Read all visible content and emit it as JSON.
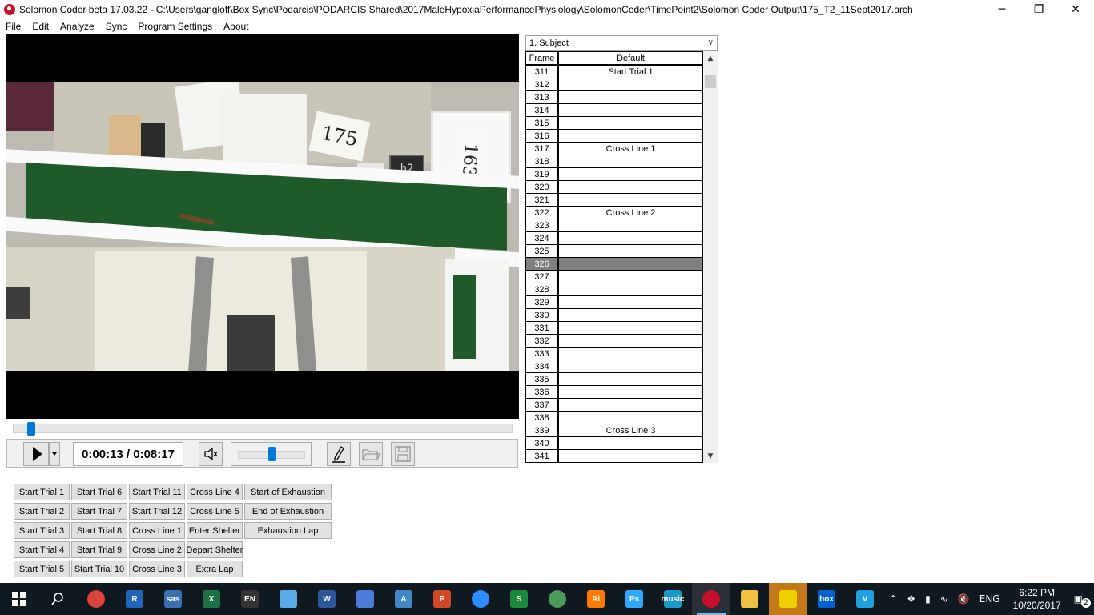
{
  "window": {
    "title": "Solomon Coder beta 17.03.22  -  C:\\Users\\gangloff\\Box Sync\\Podarcis\\PODARCIS Shared\\2017MaleHypoxiaPerformancePhysiology\\SolomonCoder\\TimePoint2\\Solomon Coder Output\\175_T2_11Sept2017.arch",
    "minimize": "─",
    "restore": "❐",
    "close": "✕"
  },
  "menu": [
    "File",
    "Edit",
    "Analyze",
    "Sync",
    "Program Settings",
    "About"
  ],
  "video": {
    "card_number": "175",
    "side_number": "163",
    "timer_display": "h2",
    "seek_position": 0.027
  },
  "player": {
    "time": "0:00:13 / 0:08:17",
    "volume_level": 0.5
  },
  "behaviors": [
    [
      "Start Trial 1",
      "Start Trial 2",
      "Start Trial 3",
      "Start Trial 4",
      "Start Trial 5"
    ],
    [
      "Start Trial 6",
      "Start Trial 7",
      "Start Trial 8",
      "Start Trial 9",
      "Start Trial 10"
    ],
    [
      "Start Trial 11",
      "Start Trial 12",
      "Cross Line 1",
      "Cross Line 2",
      "Cross Line 3"
    ],
    [
      "Cross Line 4",
      "Cross Line 5",
      "Enter Shelter",
      "Depart Shelter",
      "Extra Lap"
    ],
    [
      "Start of Exhaustion",
      "End of Exhaustion",
      "Exhaustion Lap"
    ]
  ],
  "subject_select": "1. Subject",
  "grid": {
    "headers": {
      "frame": "Frame",
      "default": "Default"
    },
    "selected_frame": "326",
    "rows": [
      {
        "frame": "311",
        "label": "Start Trial 1"
      },
      {
        "frame": "312",
        "label": ""
      },
      {
        "frame": "313",
        "label": ""
      },
      {
        "frame": "314",
        "label": ""
      },
      {
        "frame": "315",
        "label": ""
      },
      {
        "frame": "316",
        "label": ""
      },
      {
        "frame": "317",
        "label": "Cross Line 1"
      },
      {
        "frame": "318",
        "label": ""
      },
      {
        "frame": "319",
        "label": ""
      },
      {
        "frame": "320",
        "label": ""
      },
      {
        "frame": "321",
        "label": ""
      },
      {
        "frame": "322",
        "label": "Cross Line 2"
      },
      {
        "frame": "323",
        "label": ""
      },
      {
        "frame": "324",
        "label": ""
      },
      {
        "frame": "325",
        "label": ""
      },
      {
        "frame": "326",
        "label": ""
      },
      {
        "frame": "327",
        "label": ""
      },
      {
        "frame": "328",
        "label": ""
      },
      {
        "frame": "329",
        "label": ""
      },
      {
        "frame": "330",
        "label": ""
      },
      {
        "frame": "331",
        "label": ""
      },
      {
        "frame": "332",
        "label": ""
      },
      {
        "frame": "333",
        "label": ""
      },
      {
        "frame": "334",
        "label": ""
      },
      {
        "frame": "335",
        "label": ""
      },
      {
        "frame": "336",
        "label": ""
      },
      {
        "frame": "337",
        "label": ""
      },
      {
        "frame": "338",
        "label": ""
      },
      {
        "frame": "339",
        "label": "Cross Line 3"
      },
      {
        "frame": "340",
        "label": ""
      },
      {
        "frame": "341",
        "label": ""
      }
    ]
  },
  "taskbar": {
    "apps": [
      {
        "name": "windows-start-icon",
        "glyph": "",
        "color": "#ffffff"
      },
      {
        "name": "search-icon",
        "glyph": "",
        "color": "#ffffff"
      },
      {
        "name": "chrome-icon",
        "glyph": "",
        "color": "#db4437"
      },
      {
        "name": "r-icon",
        "glyph": "R",
        "color": "#2165b6"
      },
      {
        "name": "sas-icon",
        "glyph": "sas",
        "color": "#3a6fb0"
      },
      {
        "name": "excel-icon",
        "glyph": "X",
        "color": "#1e7145"
      },
      {
        "name": "endnote-icon",
        "glyph": "EN",
        "color": "#333333"
      },
      {
        "name": "paint-icon",
        "glyph": "",
        "color": "#5aa9e6"
      },
      {
        "name": "word-icon",
        "glyph": "W",
        "color": "#2b579a"
      },
      {
        "name": "remote-desktop-icon",
        "glyph": "",
        "color": "#4c7bd9"
      },
      {
        "name": "accessories-icon",
        "glyph": "A",
        "color": "#3f88c5"
      },
      {
        "name": "powerpoint-icon",
        "glyph": "P",
        "color": "#d24726"
      },
      {
        "name": "zoom-icon",
        "glyph": "",
        "color": "#2d8cff"
      },
      {
        "name": "solomon-s-icon",
        "glyph": "S",
        "color": "#1b8a3c"
      },
      {
        "name": "globe-icon",
        "glyph": "",
        "color": "#4a9a5a"
      },
      {
        "name": "illustrator-icon",
        "glyph": "Ai",
        "color": "#ff7c00"
      },
      {
        "name": "photoshop-icon",
        "glyph": "Ps",
        "color": "#31a8ff"
      },
      {
        "name": "amazon-music-icon",
        "glyph": "music",
        "color": "#1a98c8"
      },
      {
        "name": "solomon-coder-taskbar-icon",
        "glyph": "",
        "color": "#c8102e"
      },
      {
        "name": "file-explorer-icon",
        "glyph": "",
        "color": "#f0c040"
      },
      {
        "name": "gecko-app-icon",
        "glyph": "",
        "color": "#f0d000"
      },
      {
        "name": "box-icon",
        "glyph": "box",
        "color": "#0061d5"
      },
      {
        "name": "v-app-icon",
        "glyph": "V",
        "color": "#1fa0e0"
      }
    ],
    "language": "ENG",
    "time": "6:22 PM",
    "date": "10/20/2017",
    "notification_count": "2"
  }
}
